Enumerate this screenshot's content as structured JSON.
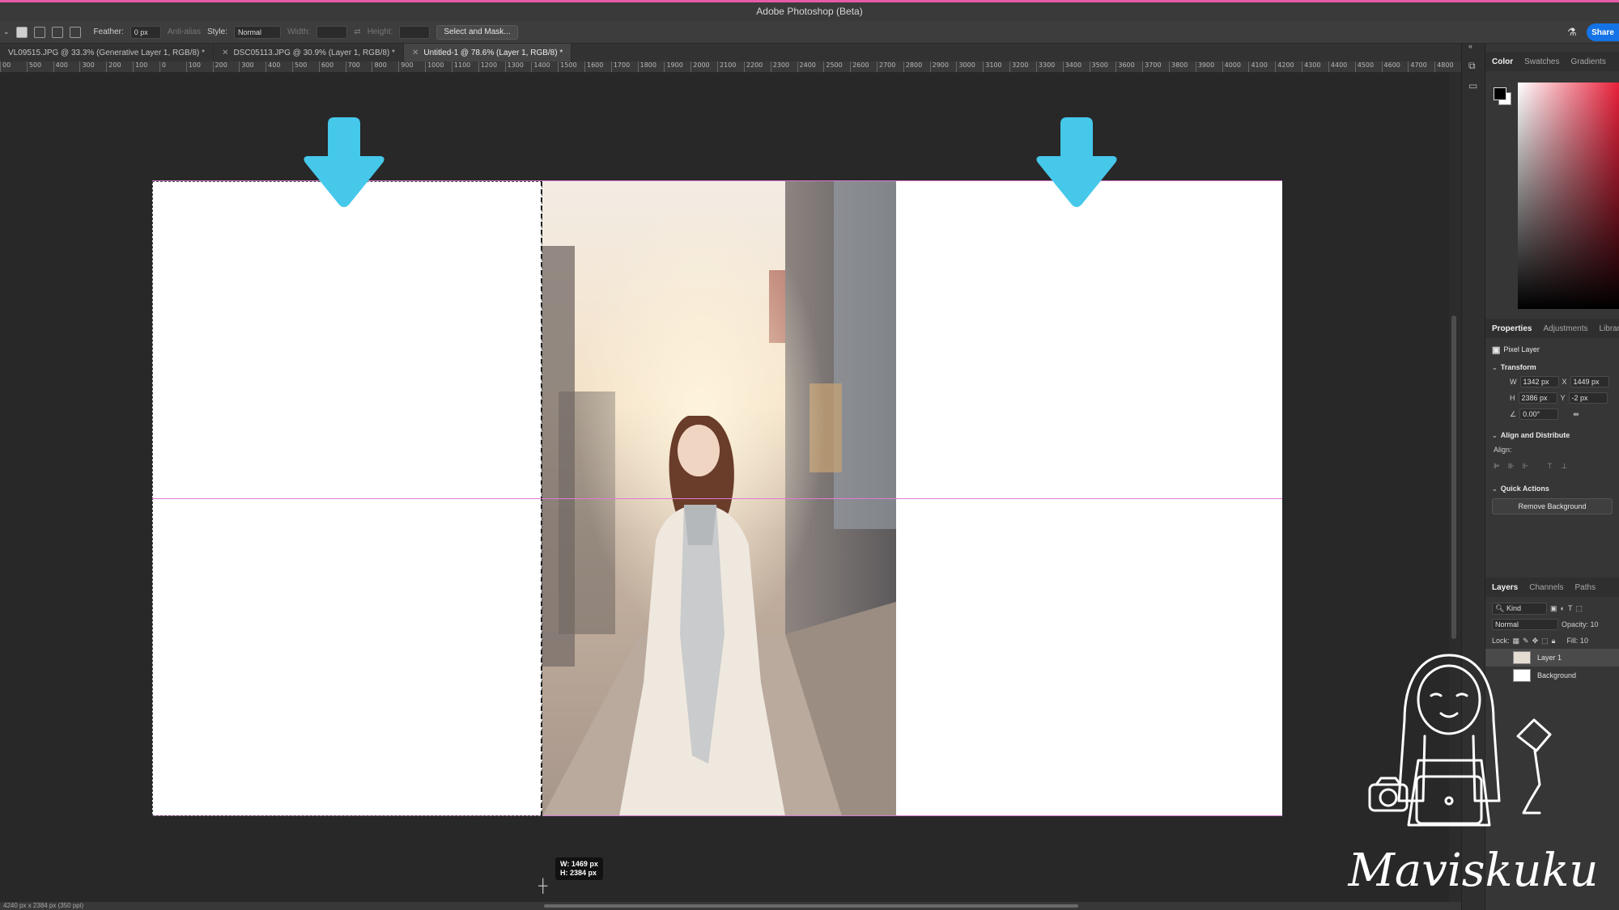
{
  "window": {
    "title": "Adobe Photoshop (Beta)"
  },
  "options_bar": {
    "feather_label": "Feather:",
    "feather_value": "0 px",
    "anti_alias_label": "Anti-alias",
    "style_label": "Style:",
    "style_value": "Normal",
    "width_label": "Width:",
    "height_label": "Height:",
    "select_mask_label": "Select and Mask...",
    "share_label": "Share"
  },
  "tabs": [
    {
      "label": "VL09515.JPG @ 33.3% (Generative Layer 1, RGB/8) *"
    },
    {
      "label": "DSC05113.JPG @ 30.9% (Layer 1, RGB/8) *"
    },
    {
      "label": "Untitled-1 @ 78.6% (Layer 1, RGB/8) *"
    }
  ],
  "ruler": {
    "labels": [
      "00",
      "500",
      "400",
      "300",
      "200",
      "100",
      "0",
      "100",
      "200",
      "300",
      "400",
      "500",
      "600",
      "700",
      "800",
      "900",
      "1000",
      "1100",
      "1200",
      "1300",
      "1400",
      "1500",
      "1600",
      "1700",
      "1800",
      "1900",
      "2000",
      "2100",
      "2200",
      "2300",
      "2400",
      "2500",
      "2600",
      "2700",
      "2800",
      "2900",
      "3000",
      "3100",
      "3200",
      "3300",
      "3400",
      "3500",
      "3600",
      "3700",
      "3800",
      "3900",
      "4000",
      "4100",
      "4200",
      "4300",
      "4400",
      "4500",
      "4600",
      "4700",
      "4800"
    ]
  },
  "canvas": {
    "tooltip_w": "W: 1469 px",
    "tooltip_h": "H: 2384 px"
  },
  "status": {
    "text": "4240 px x 2384 px (350 ppi)"
  },
  "color_panel": {
    "tabs": [
      "Color",
      "Swatches",
      "Gradients"
    ]
  },
  "properties_panel": {
    "tabs": [
      "Properties",
      "Adjustments",
      "Librar"
    ],
    "layer_type": "Pixel Layer",
    "transform_title": "Transform",
    "w_label": "W",
    "w_value": "1342 px",
    "x_label": "X",
    "x_value": "1449 px",
    "h_label": "H",
    "h_value": "2386 px",
    "y_label": "Y",
    "y_value": "-2 px",
    "angle_value": "0.00°",
    "align_title": "Align and Distribute",
    "align_label": "Align:",
    "quick_actions_title": "Quick Actions",
    "remove_bg_label": "Remove Background"
  },
  "layers_panel": {
    "tabs": [
      "Layers",
      "Channels",
      "Paths"
    ],
    "kind_label": "Kind",
    "blend_mode": "Normal",
    "opacity_label": "Opacity: 10",
    "lock_label": "Lock:",
    "fill_label": "Fill: 10",
    "layers": [
      {
        "name": "Layer 1"
      },
      {
        "name": "Background"
      }
    ]
  },
  "watermark": {
    "text": "Maviskuku"
  },
  "colors": {
    "accent": "#1473e6",
    "arrow": "#45c8ea",
    "guide": "#e37ad6"
  }
}
